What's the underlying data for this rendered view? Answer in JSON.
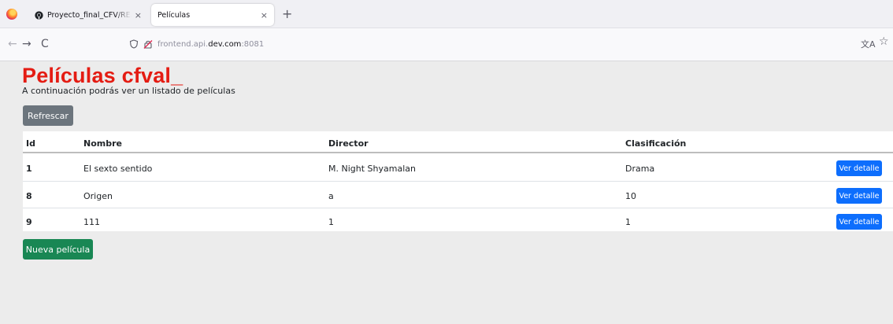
{
  "browser": {
    "tabs": [
      {
        "title": "Proyecto_final_CFV/README",
        "active": false,
        "icon": "github-icon"
      },
      {
        "title": "Películas",
        "active": true
      }
    ],
    "tab_close": "×",
    "new_tab": "+",
    "url_host_prefix": "frontend.api.",
    "url_host_domain": "dev.com",
    "url_port": ":8081",
    "nav": {
      "back": "←",
      "forward": "→",
      "reload": "C"
    },
    "translate": "⽂A",
    "bookmark": "☆"
  },
  "page": {
    "title": "Películas cfval_",
    "subtitle": "A continuación podrás ver un listado de películas",
    "refresh_button": "Refrescar",
    "new_button": "Nueva película",
    "title_color": "#e41c13"
  },
  "table": {
    "columns": [
      "Id",
      "Nombre",
      "Director",
      "Clasificación"
    ],
    "detail_button": "Ver detalle",
    "rows": [
      {
        "id": "1",
        "nombre": "El sexto sentido",
        "director": "M. Night Shyamalan",
        "clasificacion": "Drama"
      },
      {
        "id": "8",
        "nombre": "Origen",
        "director": "a",
        "clasificacion": "10"
      },
      {
        "id": "9",
        "nombre": "111",
        "director": "1",
        "clasificacion": "1"
      }
    ]
  }
}
